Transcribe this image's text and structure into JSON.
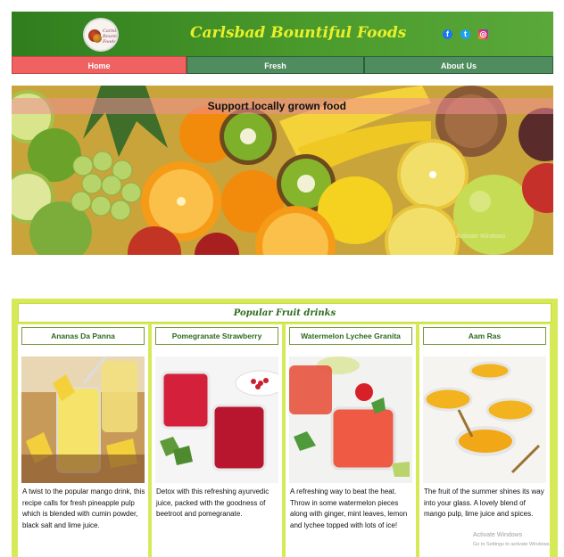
{
  "header": {
    "site_title": "Carlsbad Bountiful Foods",
    "logo_text": "Carlsbad Bountiful Foods",
    "social": [
      {
        "icon": "facebook-icon",
        "glyph": "f"
      },
      {
        "icon": "twitter-icon",
        "glyph": "t"
      },
      {
        "icon": "instagram-icon",
        "glyph": "◎"
      }
    ]
  },
  "nav": {
    "items": [
      {
        "label": "Home",
        "active": true
      },
      {
        "label": "Fresh",
        "active": false
      },
      {
        "label": "About Us",
        "active": false
      }
    ]
  },
  "hero": {
    "tagline": "Support locally grown food",
    "watermark": "Activate Windows"
  },
  "drinks": {
    "heading": "Popular Fruit drinks",
    "cards": [
      {
        "title": "Ananas Da Panna",
        "description": "A twist to the popular mango drink, this recipe calls for fresh pineapple pulp which is blended with cumin powder, black salt and lime juice."
      },
      {
        "title": "Pomegranate Strawberry",
        "description": "Detox with this refreshing ayurvedic juice, packed with the goodness of beetroot and pomegranate."
      },
      {
        "title": "Watermelon Lychee Granita",
        "description": "A refreshing way to beat the heat. Throw in some watermelon pieces along with ginger, mint leaves, lemon and lychee topped with lots of ice!"
      },
      {
        "title": "Aam Ras",
        "description": "The fruit of the summer shines its way into your glass. A lovely blend of mango pulp, lime juice and spices."
      }
    ],
    "watermark_line1": "Activate Windows",
    "watermark_line2": "Go to Settings to activate Windows."
  },
  "colors": {
    "header_green": "#3d8a22",
    "title_yellow": "#e8f02a",
    "nav_active": "#f06161",
    "nav_default": "#4f8d5f",
    "section_bg": "#d6ea58"
  }
}
